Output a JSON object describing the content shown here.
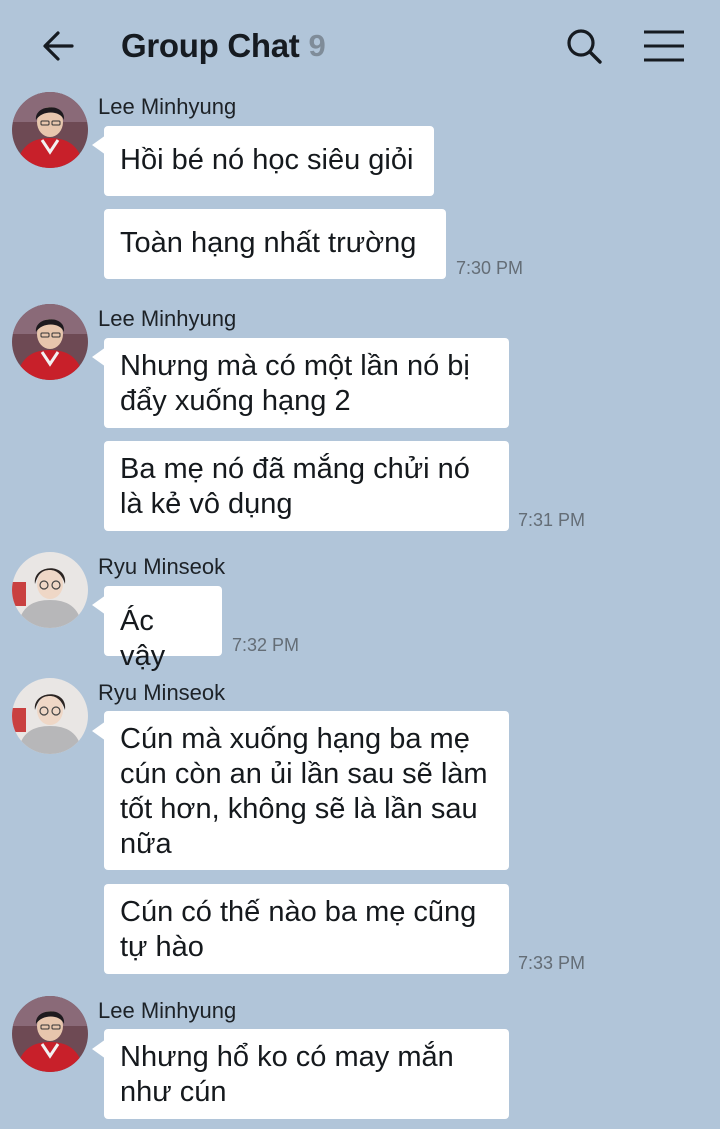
{
  "header": {
    "title": "Group Chat",
    "member_count": "9",
    "back_icon": "arrow-left-icon",
    "search_icon": "search-icon",
    "menu_icon": "hamburger-menu-icon"
  },
  "colors": {
    "background": "#b1c5d9",
    "bubble": "#ffffff",
    "title": "#161b21",
    "count": "#7f8c99",
    "time": "#646d76"
  },
  "messages": [
    {
      "sender": "Lee Minhyung",
      "avatar": "avatar-red-jacket",
      "bubbles": [
        "Hồi bé nó học siêu giỏi",
        "Toàn hạng nhất trường"
      ],
      "time": "7:30 PM"
    },
    {
      "sender": "Lee Minhyung",
      "avatar": "avatar-red-jacket",
      "bubbles": [
        "Nhưng mà có một lần nó bị đẩy xuống hạng 2",
        "Ba mẹ nó đã mắng chửi nó là kẻ vô dụng"
      ],
      "time": "7:31 PM"
    },
    {
      "sender": "Ryu Minseok",
      "avatar": "avatar-grey-hoodie",
      "bubbles": [
        "Ác vậy"
      ],
      "time": "7:32 PM"
    },
    {
      "sender": "Ryu Minseok",
      "avatar": "avatar-grey-hoodie",
      "bubbles": [
        "Cún mà xuống hạng ba mẹ cún còn an ủi lần sau sẽ làm tốt hơn, không sẽ là lần sau nữa",
        "Cún có thế nào ba mẹ cũng tự hào"
      ],
      "time": "7:33 PM"
    },
    {
      "sender": "Lee Minhyung",
      "avatar": "avatar-red-jacket",
      "bubbles": [
        "Nhưng hổ ko có may mắn như cún"
      ],
      "time": ""
    }
  ]
}
